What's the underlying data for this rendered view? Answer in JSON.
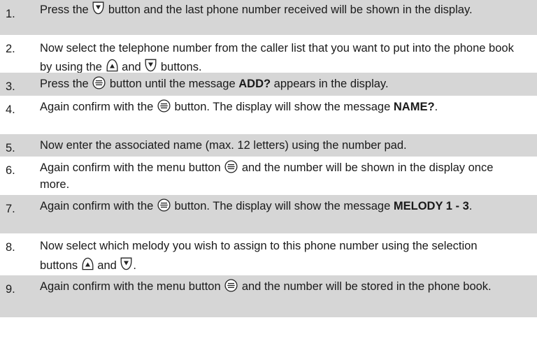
{
  "steps": [
    {
      "number": "1.",
      "parts": [
        {
          "t": "text",
          "v": "Press the "
        },
        {
          "t": "icon",
          "v": "down-arrow-button-icon"
        },
        {
          "t": "text",
          "v": " button and the last phone number received will be shown in the display."
        }
      ]
    },
    {
      "number": "2.",
      "parts": [
        {
          "t": "text",
          "v": "Now select the telephone number from the caller list that you want to put into the phone book by using the "
        },
        {
          "t": "icon",
          "v": "up-arrow-button-icon"
        },
        {
          "t": "text",
          "v": " and "
        },
        {
          "t": "icon",
          "v": "down-arrow-button-icon"
        },
        {
          "t": "text",
          "v": " buttons."
        }
      ]
    },
    {
      "number": "3.",
      "parts": [
        {
          "t": "text",
          "v": "Press the "
        },
        {
          "t": "icon",
          "v": "menu-button-icon"
        },
        {
          "t": "text",
          "v": " button until the message "
        },
        {
          "t": "bold",
          "v": "ADD?"
        },
        {
          "t": "text",
          "v": " appears in the display."
        }
      ]
    },
    {
      "number": "4.",
      "parts": [
        {
          "t": "text",
          "v": "Again confirm with the "
        },
        {
          "t": "icon",
          "v": "menu-button-icon"
        },
        {
          "t": "text",
          "v": " button. The display will show the message "
        },
        {
          "t": "bold",
          "v": "NAME?"
        },
        {
          "t": "text",
          "v": "."
        }
      ]
    },
    {
      "number": "5.",
      "parts": [
        {
          "t": "text",
          "v": "Now enter the associated name (max. 12 letters) using the number pad."
        }
      ]
    },
    {
      "number": "6.",
      "parts": [
        {
          "t": "text",
          "v": "Again confirm with the menu button "
        },
        {
          "t": "icon",
          "v": "menu-button-icon"
        },
        {
          "t": "text",
          "v": " and the number will be shown in the display once more."
        }
      ]
    },
    {
      "number": "7.",
      "parts": [
        {
          "t": "text",
          "v": "Again confirm with the "
        },
        {
          "t": "icon",
          "v": "menu-button-icon"
        },
        {
          "t": "text",
          "v": " button. The display will show the message "
        },
        {
          "t": "bold",
          "v": "MELODY 1 - 3"
        },
        {
          "t": "text",
          "v": "."
        }
      ]
    },
    {
      "number": "8.",
      "parts": [
        {
          "t": "text",
          "v": "Now select which melody you wish to assign to this phone number using the selection buttons "
        },
        {
          "t": "icon",
          "v": "up-arrow-button-icon"
        },
        {
          "t": "text",
          "v": " and "
        },
        {
          "t": "icon",
          "v": "down-arrow-button-icon"
        },
        {
          "t": "text",
          "v": "."
        }
      ]
    },
    {
      "number": "9.",
      "parts": [
        {
          "t": "text",
          "v": "Again confirm with the menu button "
        },
        {
          "t": "icon",
          "v": "menu-button-icon"
        },
        {
          "t": "text",
          "v": " and the number will be stored in the phone book."
        }
      ]
    }
  ]
}
